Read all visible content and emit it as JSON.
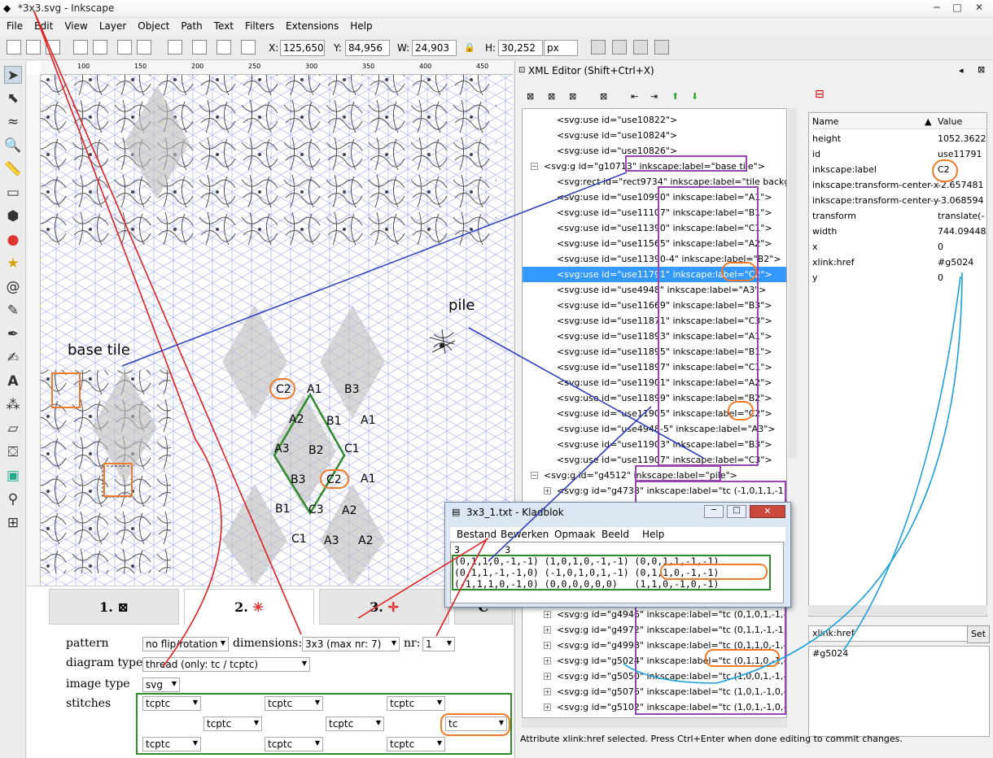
{
  "window": {
    "title": "*3x3.svg - Inkscape"
  },
  "menu": [
    "File",
    "Edit",
    "View",
    "Layer",
    "Object",
    "Path",
    "Text",
    "Filters",
    "Extensions",
    "Help"
  ],
  "toolbar": {
    "x_label": "X:",
    "x": "125,650",
    "y_label": "Y:",
    "y": "84,956",
    "w_label": "W:",
    "w": "24,903",
    "h_label": "H:",
    "h": "30,252",
    "unit": "px"
  },
  "rulers": [
    "100",
    "150",
    "200",
    "250",
    "300",
    "350",
    "400",
    "450",
    "500"
  ],
  "canvas": {
    "base_tile": "base tile",
    "pile": "pile",
    "labels": [
      [
        "C2",
        "A1",
        "B3"
      ],
      [
        "A2",
        "B1",
        "A1"
      ],
      [
        "A3",
        "B2",
        "C1"
      ],
      [
        "B3",
        "C2",
        "A1"
      ],
      [
        "B1",
        "C3",
        "A2"
      ],
      [
        "C1",
        "A3",
        "A2"
      ]
    ]
  },
  "bottom": {
    "tabs": [
      "1.",
      "2.",
      "3.",
      "C"
    ],
    "pattern_label": "pattern",
    "pattern": "no flip/rotation",
    "dimensions_label": "dimensions:",
    "dimensions": "3x3 (max nr: 7)",
    "nr_label": "nr:",
    "nr": "1",
    "diagram_label": "diagram type",
    "diagram": "thread (only: tc / tcptc)",
    "image_label": "image type",
    "image": "svg",
    "stitches_label": "stitches",
    "stitches": [
      [
        "tcptc",
        "tcptc",
        "tcptc"
      ],
      [
        "tcptc",
        "tcptc",
        "tc"
      ],
      [
        "tcptc",
        "tcptc",
        "tcptc"
      ]
    ]
  },
  "xml": {
    "title": "XML Editor (Shift+Ctrl+X)",
    "nodes": [
      {
        "t": "<svg:use id=\"use10822\">",
        "d": 2
      },
      {
        "t": "<svg:use id=\"use10824\">",
        "d": 2
      },
      {
        "t": "<svg:use id=\"use10826\">",
        "d": 2
      },
      {
        "t": "<svg:g id=\"g10713\" inkscape:label=\"base tile\">",
        "d": 1,
        "e": "⊟"
      },
      {
        "t": "<svg:rect id=\"rect9734\" inkscape:label=\"tile backgrou",
        "d": 2
      },
      {
        "t": "<svg:use id=\"use10990\" inkscape:label=\"A1\">",
        "d": 2
      },
      {
        "t": "<svg:use id=\"use11107\" inkscape:label=\"B1\">",
        "d": 2
      },
      {
        "t": "<svg:use id=\"use11390\" inkscape:label=\"C1\">",
        "d": 2
      },
      {
        "t": "<svg:use id=\"use11565\" inkscape:label=\"A2\">",
        "d": 2
      },
      {
        "t": "<svg:use id=\"use11390-4\" inkscape:label=\"B2\">",
        "d": 2
      },
      {
        "t": "<svg:use id=\"use11791\" inkscape:label=\"C2\">",
        "d": 2,
        "s": true
      },
      {
        "t": "<svg:use id=\"use4948\" inkscape:label=\"A3\">",
        "d": 2
      },
      {
        "t": "<svg:use id=\"use11669\" inkscape:label=\"B3\">",
        "d": 2
      },
      {
        "t": "<svg:use id=\"use11871\" inkscape:label=\"C3\">",
        "d": 2
      },
      {
        "t": "<svg:use id=\"use11893\" inkscape:label=\"A1\">",
        "d": 2
      },
      {
        "t": "<svg:use id=\"use11895\" inkscape:label=\"B1\">",
        "d": 2
      },
      {
        "t": "<svg:use id=\"use11897\" inkscape:label=\"C1\">",
        "d": 2
      },
      {
        "t": "<svg:use id=\"use11901\" inkscape:label=\"A2\">",
        "d": 2
      },
      {
        "t": "<svg:use id=\"use11899\" inkscape:label=\"B2\">",
        "d": 2
      },
      {
        "t": "<svg:use id=\"use11905\" inkscape:label=\"C2\">",
        "d": 2
      },
      {
        "t": "<svg:use id=\"use4948-5\" inkscape:label=\"A3\">",
        "d": 2
      },
      {
        "t": "<svg:use id=\"use11903\" inkscape:label=\"B3\">",
        "d": 2
      },
      {
        "t": "<svg:use id=\"use11907\" inkscape:label=\"C3\">",
        "d": 2
      },
      {
        "t": "<svg:g id=\"g4512\" inkscape:label=\"pile\">",
        "d": 1,
        "e": "⊟"
      },
      {
        "t": "<svg:g id=\"g4738\" inkscape:label=\"tc (-1,0,1,1,-1,0)\">",
        "d": 2,
        "e": "⊞"
      },
      {
        "t": "<svg:g id=\"g4764\" inkscape:label=\"tc (-1,0,1,1,-1,0)\">",
        "d": 2,
        "e": "⊞"
      },
      {
        "t": "",
        "d": 2
      },
      {
        "t": "",
        "d": 2
      },
      {
        "t": "",
        "d": 2
      },
      {
        "t": "",
        "d": 2
      },
      {
        "t": "",
        "d": 2
      },
      {
        "t": "",
        "d": 2
      },
      {
        "t": "<svg:g id=\"g4946\" inkscape:label=\"tc (0,1,0,1,-1,-1)\">",
        "d": 2,
        "e": "⊞"
      },
      {
        "t": "<svg:g id=\"g4972\" inkscape:label=\"tc (0,1,1,-1,-1,0)\">",
        "d": 2,
        "e": "⊞"
      },
      {
        "t": "<svg:g id=\"g4998\" inkscape:label=\"tc (0,1,1,0,-1,-1)\">",
        "d": 2,
        "e": "⊞"
      },
      {
        "t": "<svg:g id=\"g5024\" inkscape:label=\"tc (0,1,1,0,-1,-1)\">",
        "d": 2,
        "e": "⊞"
      },
      {
        "t": "<svg:g id=\"g5050\" inkscape:label=\"tc (1,0,0,1,-1,-1)\">",
        "d": 2,
        "e": "⊞"
      },
      {
        "t": "<svg:g id=\"g5076\" inkscape:label=\"tc (1,0,1,-1,0,-1)\">",
        "d": 2,
        "e": "⊞"
      },
      {
        "t": "<svg:g id=\"g5102\" inkscape:label=\"tc (1,0,1,-1,0,-1)\">",
        "d": 2,
        "e": "⊞"
      }
    ],
    "attr_header": [
      "Name",
      "Value"
    ],
    "attrs": [
      [
        "height",
        "1052.3622"
      ],
      [
        "id",
        "use11791"
      ],
      [
        "inkscape:label",
        "C2"
      ],
      [
        "inkscape:transform-center-x",
        "-2.657481"
      ],
      [
        "inkscape:transform-center-y",
        "-3.068594"
      ],
      [
        "transform",
        "translate(-"
      ],
      [
        "width",
        "744.09448"
      ],
      [
        "x",
        "0"
      ],
      [
        "xlink:href",
        "#g5024"
      ],
      [
        "y",
        "0"
      ]
    ],
    "attr_name_edit": "xlink:href",
    "set_button": "Set",
    "attr_value_edit": "#g5024",
    "status": "Attribute xlink:href selected. Press Ctrl+Enter when done editing to commit changes."
  },
  "notepad": {
    "title": "3x3_1.txt - Kladblok",
    "menu": [
      "Bestand",
      "Bewerken",
      "Opmaak",
      "Beeld",
      "Help"
    ],
    "lines": [
      "3        3",
      "(0,1,1,0,-1,-1) (1,0,1,0,-1,-1) (0,0,1,1,-1,-1)",
      "(0,1,1,-1,-1,0) (-1,0,1,0,1,-1) (0,1,1,0,-1,-1)",
      "(-1,1,1,0,-1,0) (0,0,0,0,0,0)   (1,1,0,-1,0,-1)"
    ]
  },
  "colors": {
    "annotation_purple": "#9b45b2",
    "annotation_orange": "#f07a2a",
    "annotation_green": "#2f8b2a",
    "arrow_red": "#e02020",
    "arrow_blue": "#3040c0",
    "arrow_cyan": "#1aa0dc",
    "selection": "#3399ff"
  }
}
